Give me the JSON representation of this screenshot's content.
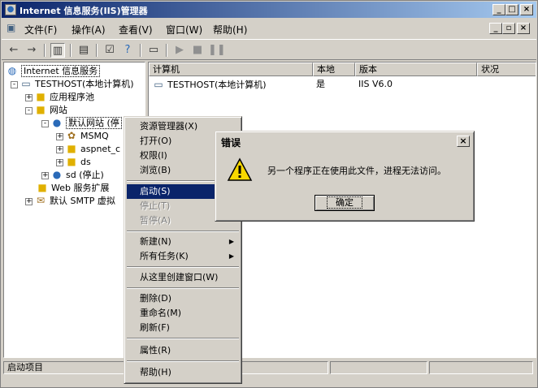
{
  "window": {
    "title": "Internet 信息服务(IIS)管理器"
  },
  "title_buttons": [
    "_",
    "□",
    "×"
  ],
  "menubar": {
    "items": [
      "文件(F)",
      "操作(A)",
      "查看(V)",
      "窗口(W)",
      "帮助(H)"
    ],
    "mdi_buttons": [
      "_",
      "▫",
      "×"
    ]
  },
  "toolbar": {
    "icons": [
      "back-icon",
      "forward-icon",
      "show-tree-icon",
      "export-icon",
      "properties-icon",
      "help-icon",
      "computer-icon",
      "play-icon",
      "stop-icon",
      "pause-icon"
    ]
  },
  "tree": {
    "items": [
      {
        "label": "Internet 信息服务",
        "level": 0,
        "icon": "iis-icon",
        "expander": ""
      },
      {
        "label": "TESTHOST(本地计算机)",
        "level": 1,
        "icon": "computer-icon",
        "expander": "-"
      },
      {
        "label": "应用程序池",
        "level": 2,
        "icon": "folder-icon",
        "expander": "+"
      },
      {
        "label": "网站",
        "level": 2,
        "icon": "folder-icon",
        "expander": "-"
      },
      {
        "label": "默认网站 (停",
        "level": 3,
        "icon": "globe-icon",
        "expander": "-"
      },
      {
        "label": "MSMQ",
        "level": 4,
        "icon": "gear-folder-icon",
        "expander": "+"
      },
      {
        "label": "aspnet_c",
        "level": 4,
        "icon": "folder-icon",
        "expander": "+"
      },
      {
        "label": "ds",
        "level": 4,
        "icon": "folder-icon",
        "expander": "+"
      },
      {
        "label": "sd (停止)",
        "level": 3,
        "icon": "globe-icon",
        "expander": "+"
      },
      {
        "label": "Web 服务扩展",
        "level": 2,
        "icon": "folder-icon",
        "expander": ""
      },
      {
        "label": "默认 SMTP 虚拟",
        "level": 2,
        "icon": "smtp-icon",
        "expander": "+"
      }
    ]
  },
  "list": {
    "columns": [
      "计算机",
      "本地",
      "版本",
      "状况"
    ],
    "rows": [
      {
        "computer": "TESTHOST(本地计算机)",
        "local": "是",
        "version": "IIS V6.0",
        "status": ""
      }
    ]
  },
  "context_menu": {
    "items": [
      {
        "label": "资源管理器(X)",
        "state": "normal",
        "submenu": false
      },
      {
        "label": "打开(O)",
        "state": "normal",
        "submenu": false
      },
      {
        "label": "权限(I)",
        "state": "normal",
        "submenu": false
      },
      {
        "label": "浏览(B)",
        "state": "normal",
        "submenu": false
      },
      {
        "sep": true
      },
      {
        "label": "启动(S)",
        "state": "highlighted",
        "submenu": false
      },
      {
        "label": "停止(T)",
        "state": "disabled",
        "submenu": false
      },
      {
        "label": "暂停(A)",
        "state": "disabled",
        "submenu": false
      },
      {
        "sep": true
      },
      {
        "label": "新建(N)",
        "state": "normal",
        "submenu": true
      },
      {
        "label": "所有任务(K)",
        "state": "normal",
        "submenu": true
      },
      {
        "sep": true
      },
      {
        "label": "从这里创建窗口(W)",
        "state": "normal",
        "submenu": false
      },
      {
        "sep": true
      },
      {
        "label": "删除(D)",
        "state": "normal",
        "submenu": false
      },
      {
        "label": "重命名(M)",
        "state": "normal",
        "submenu": false
      },
      {
        "label": "刷新(F)",
        "state": "normal",
        "submenu": false
      },
      {
        "sep": true
      },
      {
        "label": "属性(R)",
        "state": "normal",
        "submenu": false
      },
      {
        "sep": true
      },
      {
        "label": "帮助(H)",
        "state": "normal",
        "submenu": false
      }
    ]
  },
  "dialog": {
    "title": "错误",
    "message": "另一个程序正在使用此文件，进程无法访问。",
    "ok_label": "确定",
    "close_glyph": "×",
    "icon": "warning-icon"
  },
  "statusbar": {
    "text": "启动项目"
  },
  "colors": {
    "titlebar_start": "#0a246a",
    "titlebar_end": "#a6caf0",
    "face": "#d4d0c8",
    "highlight": "#0a246a"
  }
}
